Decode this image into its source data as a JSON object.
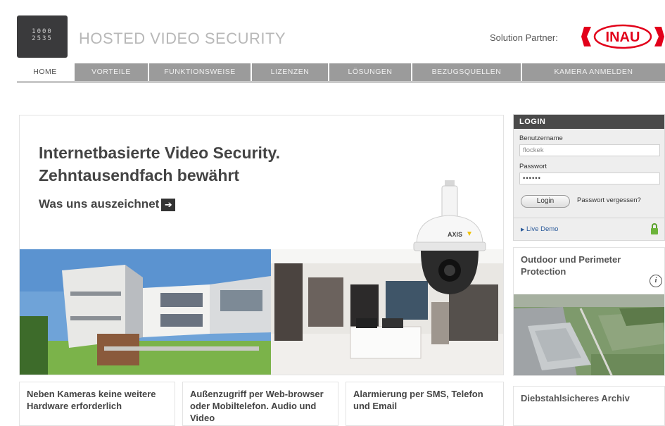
{
  "header": {
    "logo_digits": [
      "1000",
      "2535"
    ],
    "site_title": "HOSTED VIDEO SECURITY",
    "partner_label": "Solution Partner:",
    "partner_logo_text": "INAU",
    "partner_color": "#e2001a"
  },
  "nav": {
    "items": [
      {
        "label": "HOME",
        "active": true
      },
      {
        "label": "VORTEILE",
        "active": false
      },
      {
        "label": "FUNKTIONSWEISE",
        "active": false
      },
      {
        "label": "LIZENZEN",
        "active": false
      },
      {
        "label": "LÖSUNGEN",
        "active": false
      },
      {
        "label": "BEZUGSQUELLEN",
        "active": false
      },
      {
        "label": "KAMERA ANMELDEN",
        "active": false
      }
    ]
  },
  "hero": {
    "line1": "Internetbasierte Video Security.",
    "line2": "Zehntausendfach bewährt",
    "link_label": "Was uns auszeichnet",
    "camera_brand": "AXIS"
  },
  "info_boxes": [
    {
      "text": "Neben Kameras keine weitere Hardware erforderlich"
    },
    {
      "text": "Außenzugriff per Web-browser oder Mobiltelefon. Audio und Video"
    },
    {
      "text": "Alarmierung per SMS, Telefon und Email"
    }
  ],
  "login": {
    "title": "LOGIN",
    "username_label": "Benutzername",
    "username_value": "flockek",
    "password_label": "Passwort",
    "password_value": "••••••",
    "button_label": "Login",
    "forgot_label": "Passwort vergessen?",
    "live_demo_label": "Live Demo"
  },
  "promos": {
    "outdoor_title": "Outdoor und Perimeter Protection",
    "info_symbol": "i",
    "archive_title": "Diebstahlsicheres Archiv"
  }
}
